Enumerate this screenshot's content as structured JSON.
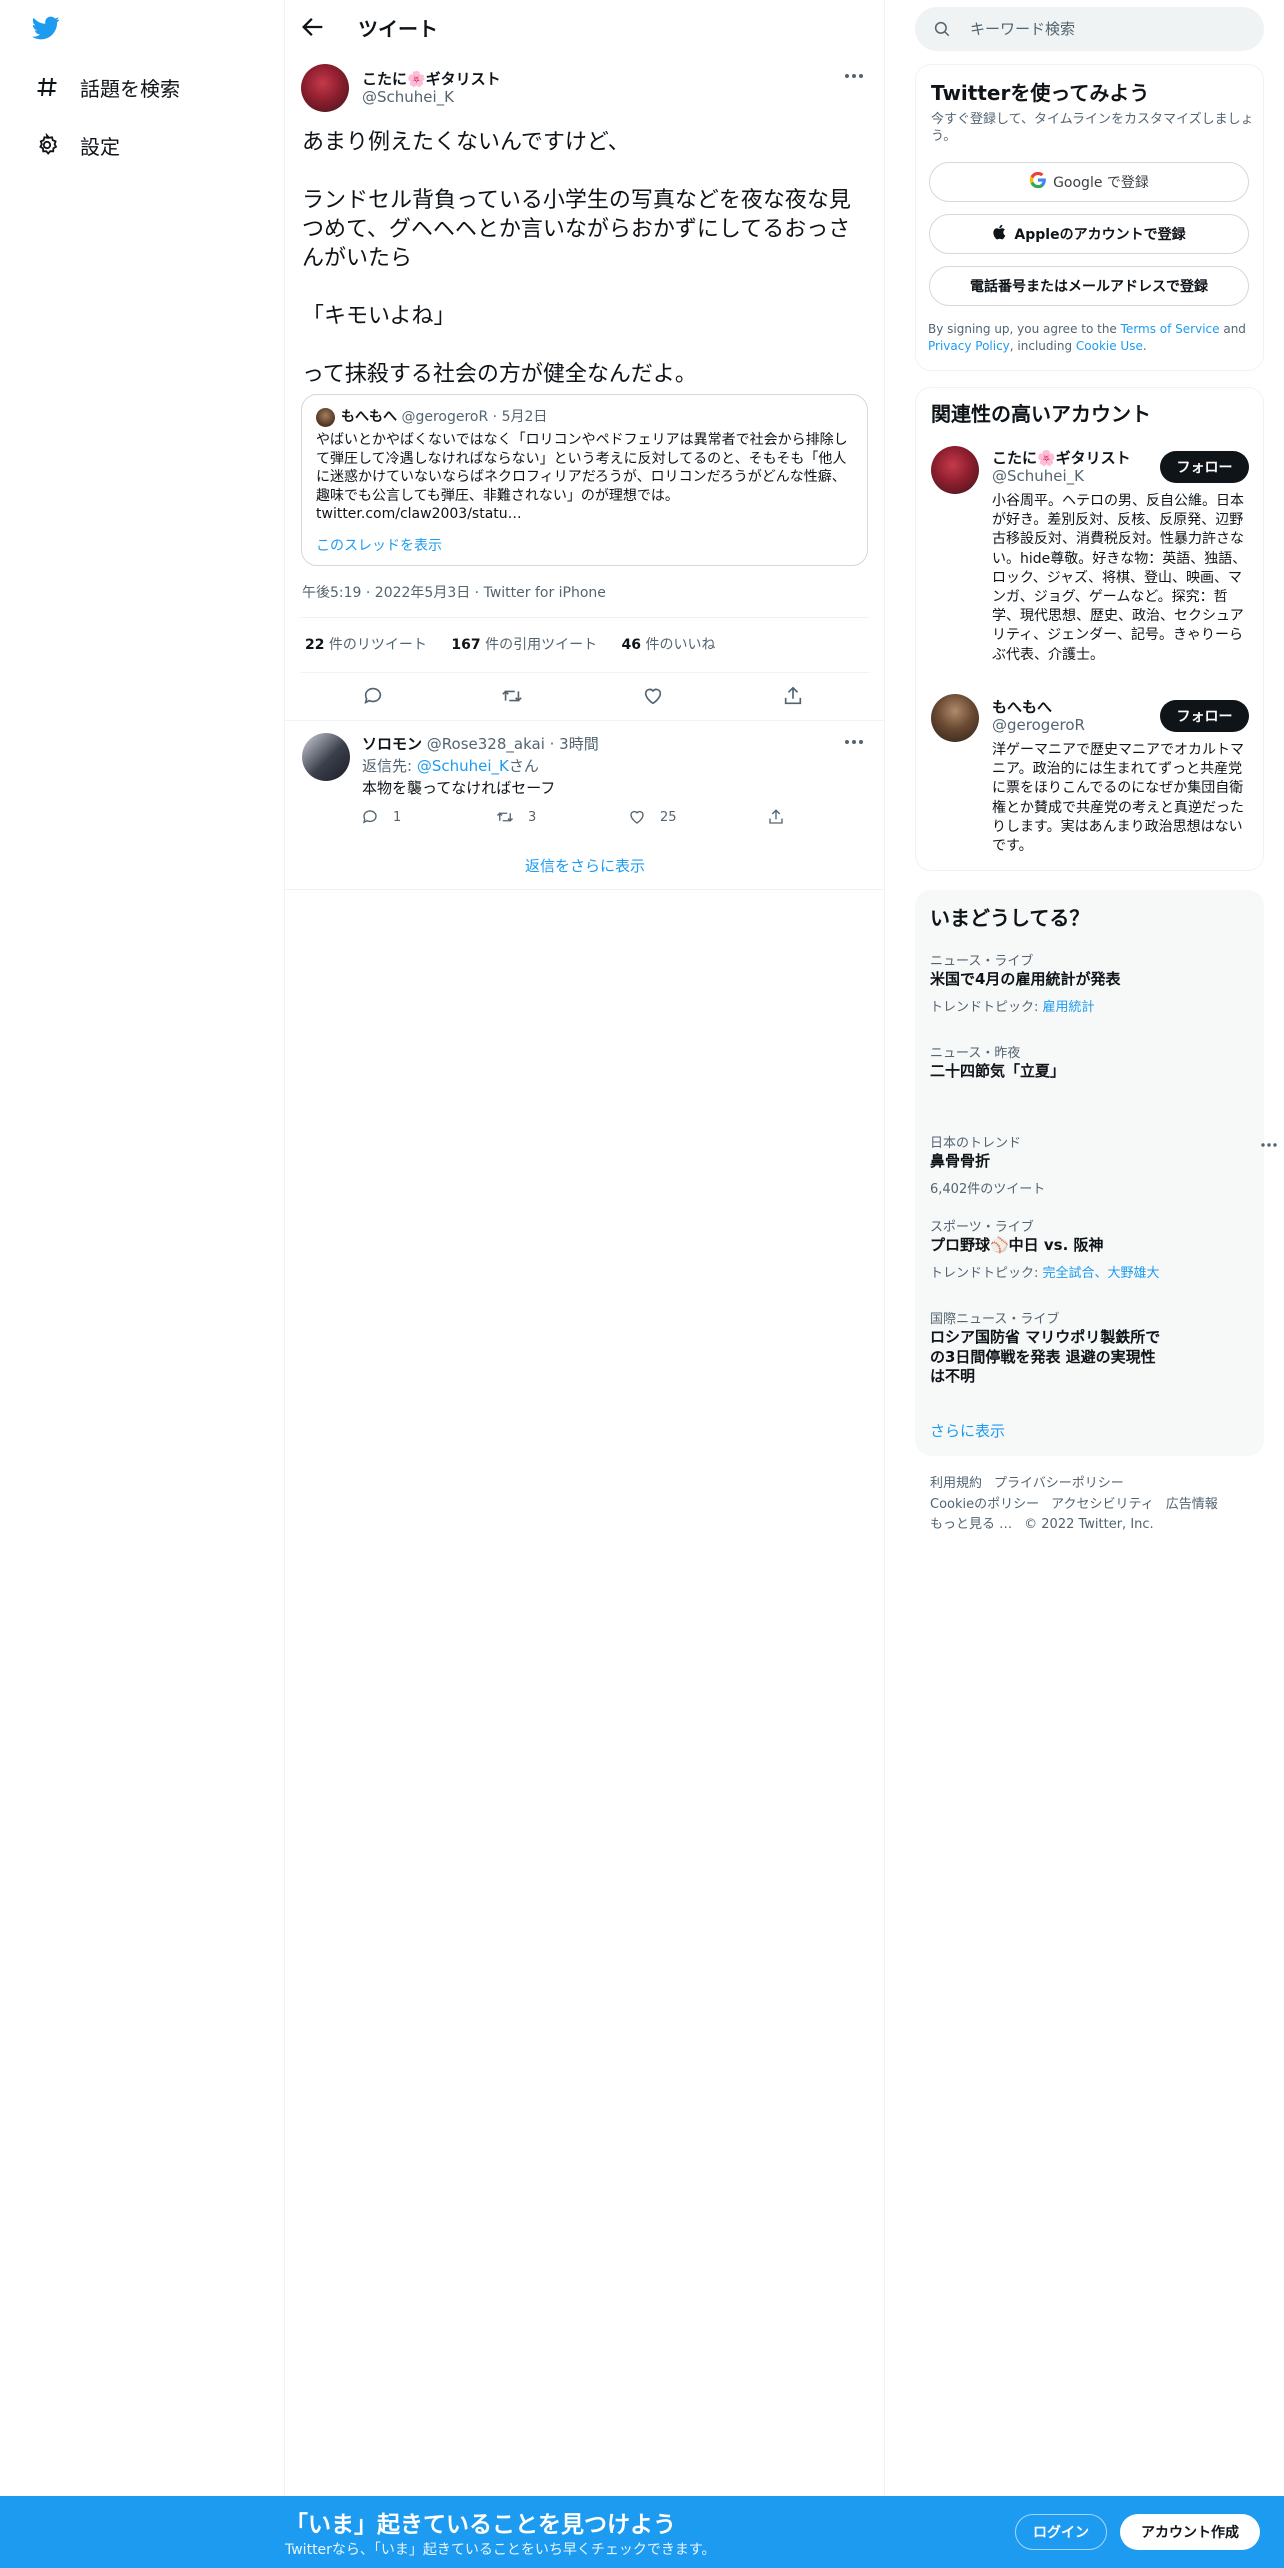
{
  "nav": {
    "explore_label": "話題を検索",
    "settings_label": "設定"
  },
  "header": {
    "title": "ツイート"
  },
  "tweet": {
    "author_name": "こたに🌸ギタリスト",
    "author_handle": "@Schuhei_K",
    "text": "あまり例えたくないんですけど、\n\nランドセル背負っている小学生の写真などを夜な夜な見つめて、グヘヘヘとか言いながらおかずにしてるおっさんがいたら\n\n「キモいよね」\n\nって抹殺する社会の方が健全なんだよ。",
    "quote": {
      "name": "もへもへ",
      "handle": "@gerogeroR",
      "date": "5月2日",
      "text": "やばいとかやばくないではなく「ロリコンやペドフェリアは異常者で社会から排除して弾圧して冷遇しなければならない」という考えに反対してるのと、そもそも「他人に迷惑かけていないならばネクロフィリアだろうが、ロリコンだろうがどんな性癖、趣味でも公言しても弾圧、非難されない」のが理想では。 twitter.com/claw2003/statu…",
      "thread_link": "このスレッドを表示"
    },
    "timestamp": "午後5:19 · 2022年5月3日 · Twitter for iPhone",
    "retweets_count": "22",
    "retweets_label": " 件のリツイート",
    "quotes_count": "167",
    "quotes_label": " 件の引用ツイート",
    "likes_count": "46",
    "likes_label": " 件のいいね"
  },
  "reply": {
    "name": "ソロモン",
    "handle_time": " @Rose328_akai · 3時間",
    "reply_to_prefix": "返信先: ",
    "reply_to_mention": "@Schuhei_K",
    "reply_to_suffix": "さん",
    "text": "本物を襲ってなければセーフ",
    "reply_count": "1",
    "retweet_count": "3",
    "like_count": "25"
  },
  "more_replies_label": "返信をさらに表示",
  "search": {
    "placeholder": "キーワード検索"
  },
  "signup": {
    "title": "Twitterを使ってみよう",
    "subtitle": "今すぐ登録して、タイムラインをカスタマイズしましょう。",
    "google_label": "Google で登録",
    "apple_label": "Appleのアカウントで登録",
    "phone_label": "電話番号またはメールアドレスで登録",
    "terms_prefix": "By signing up, you agree to the ",
    "terms_link": "Terms of Service",
    "terms_and": " and ",
    "privacy_link": "Privacy Policy",
    "terms_including": ", including ",
    "cookie_link": "Cookie Use",
    "terms_end": "."
  },
  "related": {
    "title": "関連性の高いアカウント",
    "follow_label": "フォロー",
    "accounts": [
      {
        "name": "こたに🌸ギタリスト",
        "handle": "@Schuhei_K",
        "bio": "小谷周平。ヘテロの男、反自公維。日本が好き。差別反対、反核、反原発、辺野古移設反対、消費税反対。性暴力許さない。hide尊敬。好きな物：英語、独語、ロック、ジャズ、将棋、登山、映画、マンガ、ジョグ、ゲームなど。探究：哲学、現代思想、歴史、政治、セクシュアリティ、ジェンダー、記号。きゃりーらぶ代表、介護士。"
      },
      {
        "name": "もへもへ",
        "handle": "@gerogeroR",
        "bio": "洋ゲーマニアで歴史マニアでオカルトマニア。政治的には生まれてずっと共産党に票をほりこんでるのになぜか集団自衛権とか賛成で共産党の考えと真逆だったりします。実はあんまり政治思想はないです。"
      }
    ]
  },
  "trends": {
    "title": "いまどうしてる？",
    "items": [
      {
        "category": "ニュース・ライブ",
        "name": "米国で4月の雇用統計が発表",
        "meta_prefix": "トレンドトピック: ",
        "meta_link": "雇用統計"
      },
      {
        "category": "ニュース・昨夜",
        "name": "二十四節気「立夏」"
      },
      {
        "category": "日本のトレンド",
        "name": "鼻骨骨折",
        "meta": "6,402件のツイート"
      },
      {
        "category": "スポーツ・ライブ",
        "name": "プロ野球⚾中日 vs. 阪神",
        "meta_prefix": "トレンドトピック: ",
        "meta_link": "完全試合、大野雄大"
      },
      {
        "category": "国際ニュース・ライブ",
        "name": "ロシア国防省 マリウポリ製鉄所での3日間停戦を発表 退避の実現性は不明"
      }
    ],
    "show_more": "さらに表示"
  },
  "footer": {
    "terms": "利用規約",
    "privacy": "プライバシーポリシー",
    "cookie": "Cookieのポリシー",
    "accessibility": "アクセシビリティ",
    "ads": "広告情報",
    "more": "もっと見る …",
    "copyright": "© 2022 Twitter, Inc."
  },
  "bottom_bar": {
    "title": "「いま」起きていることを見つけよう",
    "subtitle": "Twitterなら、「いま」起きていることをいち早くチェックできます。",
    "login_label": "ログイン",
    "signup_label": "アカウント作成"
  },
  "colors": {
    "accent": "#1d9bf0",
    "text": "#0f1419",
    "secondary": "#536471"
  }
}
